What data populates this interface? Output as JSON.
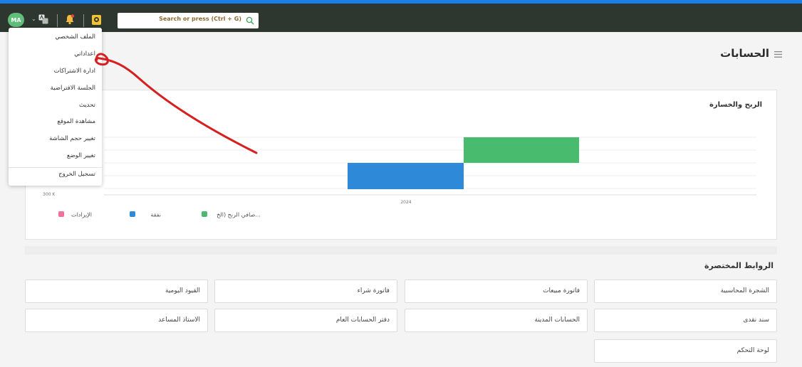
{
  "topbar": {
    "avatar_initials": "MA",
    "search_placeholder": "Search or press (Ctrl + G)"
  },
  "header": {
    "page_title": "الحسابات"
  },
  "chart_card": {
    "title": "الربح والخسارة"
  },
  "chart_data": {
    "type": "bar",
    "title": "الربح والخسارة",
    "categories": [
      "2024"
    ],
    "x_tick_labels": [
      "2024"
    ],
    "y_tick_labels": [
      "300 K"
    ],
    "series": [
      {
        "name": "صافي الربح (الخ...",
        "color": "#48bb6e"
      },
      {
        "name": "نفقة",
        "color": "#2e8ad8"
      },
      {
        "name": "الإيرادات",
        "color": "#f2709c"
      }
    ],
    "grid": true,
    "legend_position": "bottom-left"
  },
  "shortcuts": {
    "title": "الروابط المختصرة",
    "items": [
      "الشجرة المحاسبية",
      "فاتورة مبيعات",
      "فاتورة شراء",
      "القيود اليومية",
      "سند نقدى",
      "الحسابات المدينة",
      "دفتر الحسابات العام",
      "الاستاذ المساعد",
      "لوحة التحكم"
    ]
  },
  "user_menu": {
    "items": [
      "الملف الشخصي",
      "اعداداتي",
      "ادارة الاشتراكات",
      "الجلسة الافتراضية",
      "تحديث",
      "مشاهدة الموقع",
      "تغيير حجم الشاشة",
      "تغيير الوضع",
      "تسجيل الخروج"
    ]
  },
  "colors": {
    "topbar": "#2d3730",
    "accent": "#1a7ee6",
    "avatar": "#5fbf78",
    "annotation": "#d62020"
  }
}
